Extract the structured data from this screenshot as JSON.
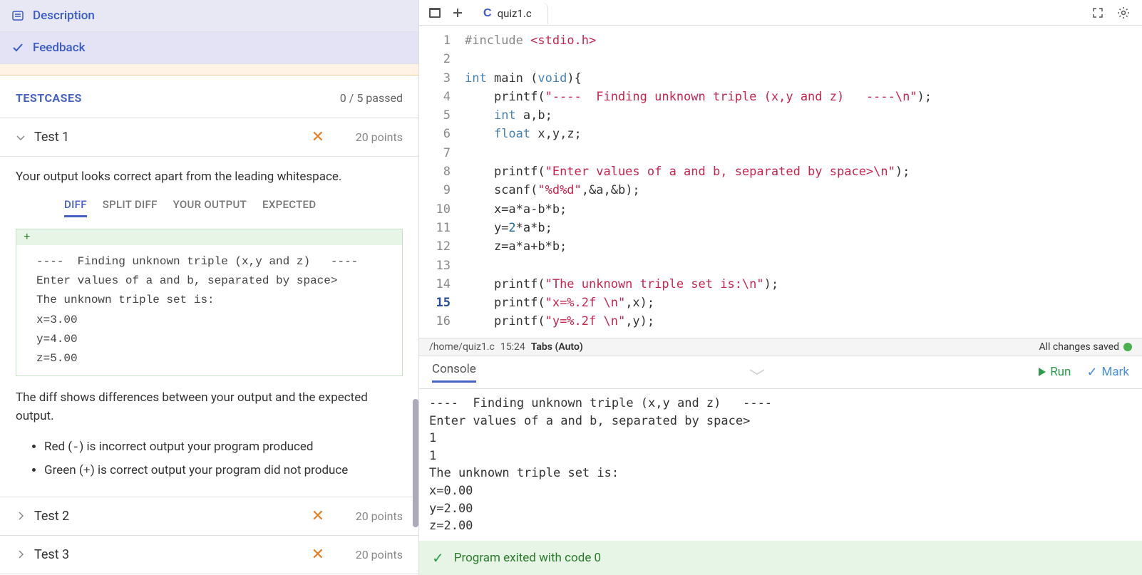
{
  "left_tabs": {
    "description": "Description",
    "feedback": "Feedback"
  },
  "testcases": {
    "title": "TESTCASES",
    "passed": "0 / 5 passed"
  },
  "tests": [
    {
      "name": "Test 1",
      "points": "20 points",
      "expanded": true
    },
    {
      "name": "Test 2",
      "points": "20 points",
      "expanded": false
    },
    {
      "name": "Test 3",
      "points": "20 points",
      "expanded": false
    }
  ],
  "test1": {
    "message": "Your output looks correct apart from the leading whitespace.",
    "subtabs": [
      "DIFF",
      "SPLIT DIFF",
      "YOUR OUTPUT",
      "EXPECTED"
    ],
    "diff_plus": "+",
    "diff_lines": [
      "----  Finding unknown triple (x,y and z)   ----",
      "Enter values of a and b, separated by space>",
      "The unknown triple set is:",
      "x=3.00",
      "y=4.00",
      "z=5.00"
    ],
    "explain": "The diff shows differences between your output and the expected output.",
    "bullets": [
      "Red (-) is incorrect output your program produced",
      "Green (+) is correct output your program did not produce"
    ],
    "bullet_glyphs": [
      "-",
      "+"
    ]
  },
  "editor": {
    "filename": "quiz1.c",
    "file_icon": "C",
    "lines": [
      {
        "n": 1,
        "html": "<span class='preproc'>#include</span> <span class='inc'>&lt;stdio.h&gt;</span>"
      },
      {
        "n": 2,
        "html": ""
      },
      {
        "n": 3,
        "html": "<span class='type'>int</span> <span class='fn'>main</span> (<span class='type'>void</span>){"
      },
      {
        "n": 4,
        "html": "    printf(<span class='str'>\"----  Finding unknown triple (x,y and z)   ----\\n\"</span>);"
      },
      {
        "n": 5,
        "html": "    <span class='type'>int</span> a,b;"
      },
      {
        "n": 6,
        "html": "    <span class='type'>float</span> x,y,z;"
      },
      {
        "n": 7,
        "html": ""
      },
      {
        "n": 8,
        "html": "    printf(<span class='str'>\"Enter values of a and b, separated by space&gt;\\n\"</span>);"
      },
      {
        "n": 9,
        "html": "    scanf(<span class='str'>\"%d%d\"</span>,&amp;a,&amp;b);"
      },
      {
        "n": 10,
        "html": "    x=a*a-b*b;"
      },
      {
        "n": 11,
        "html": "    y=<span class='num'>2</span>*a*b;"
      },
      {
        "n": 12,
        "html": "    z=a*a+b*b;"
      },
      {
        "n": 13,
        "html": ""
      },
      {
        "n": 14,
        "html": "    printf(<span class='str'>\"The unknown triple set is:\\n\"</span>);"
      },
      {
        "n": 15,
        "html": "    printf(<span class='str'>\"x=%.2f \\n\"</span>,x);",
        "active": true
      },
      {
        "n": 16,
        "html": "    printf(<span class='str'>\"y=%.2f \\n\"</span>,y);"
      }
    ]
  },
  "status": {
    "path": "/home/quiz1.c",
    "pos": "15:24",
    "tabs": "Tabs (Auto)",
    "saved": "All changes saved"
  },
  "console": {
    "tab": "Console",
    "run": "Run",
    "mark": "Mark",
    "output": "----  Finding unknown triple (x,y and z)   ----\nEnter values of a and b, separated by space>\n1\n1\nThe unknown triple set is:\nx=0.00\ny=2.00\nz=2.00",
    "exit": "Program exited with code 0"
  }
}
